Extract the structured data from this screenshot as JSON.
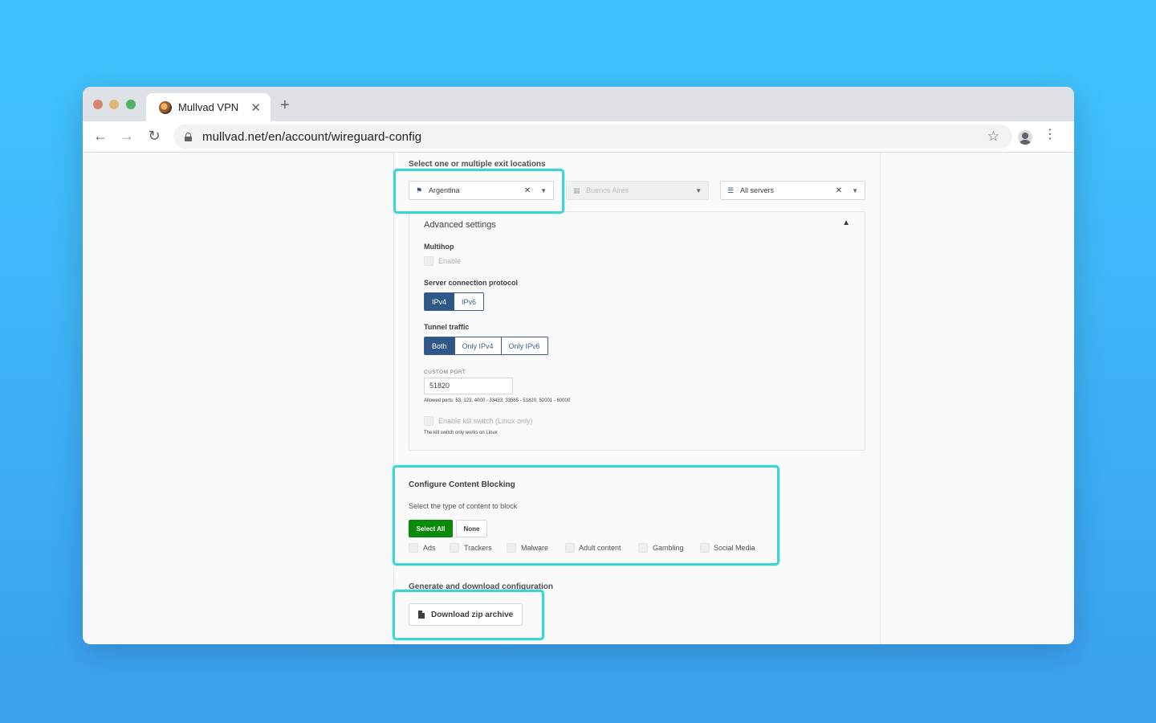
{
  "browser": {
    "tab_title": "Mullvad VPN",
    "tab_close": "✕",
    "new_tab": "+",
    "url": "mullvad.net/en/account/wireguard-config",
    "back": "←",
    "forward": "→",
    "reload": "↻",
    "star": "☆",
    "menu": "⋮"
  },
  "locations": {
    "title": "Select one or multiple exit locations",
    "country": "Argentina",
    "city": "Buenos Aires",
    "servers": "All servers",
    "clear": "✕",
    "chevron": "⌵"
  },
  "advanced": {
    "title": "Advanced settings",
    "chevron": "︿",
    "multihop_label": "Multihop",
    "multihop_enable": "Enable",
    "protocol_label": "Server connection protocol",
    "protocol_options": [
      "IPv4",
      "IPv6"
    ],
    "protocol_selected": "IPv4",
    "tunnel_label": "Tunnel traffic",
    "tunnel_options": [
      "Both",
      "Only IPv4",
      "Only IPv6"
    ],
    "tunnel_selected": "Both",
    "custom_port_label": "CUSTOM PORT",
    "custom_port_value": "51820",
    "allowed_ports": "Allowed ports: 53, 123, 4000 - 33433, 33565 - 51820, 52001 - 60000",
    "kill_switch_label": "Enable kill switch (Linux only)",
    "kill_switch_hint": "The kill switch only works on Linux"
  },
  "content_blocking": {
    "title": "Configure Content Blocking",
    "subtitle": "Select the type of content to block",
    "select_all": "Select All",
    "none": "None",
    "options": [
      "Ads",
      "Trackers",
      "Malware",
      "Adult content",
      "Gambling",
      "Social Media"
    ]
  },
  "generate": {
    "title": "Generate and download configuration",
    "download_button": "Download zip archive"
  },
  "colors": {
    "accent_blue": "#2f5889",
    "green_button": "#0a8a0a",
    "highlight": "#3ed4d6"
  }
}
